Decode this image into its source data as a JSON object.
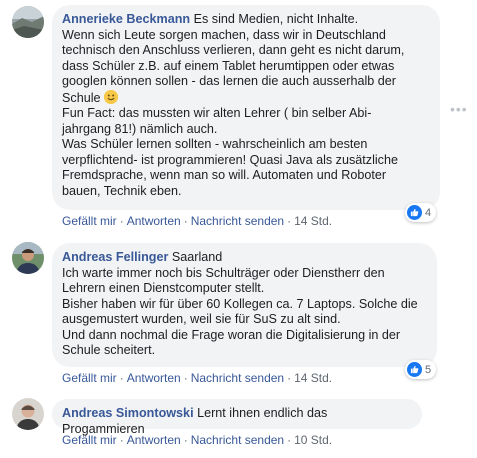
{
  "comments": [
    {
      "author": "Annerieke Beckmann",
      "text_before_emoji": " Es sind Medien, nicht Inhalte.\nWenn sich Leute sorgen machen, dass wir in Deutschland\ntechnisch den Anschluss verlieren, dann geht es nicht darum,\ndass Schüler z.B. auf einem Tablet herumtippen oder etwas\ngooglen können sollen - das lernen die auch ausserhalb der\nSchule ",
      "emoji": "smile-emoji",
      "text_after_emoji": "\nFun Fact: das mussten wir alten Lehrer ( bin selber Abi-\njahrgang 81!) nämlich auch.\nWas Schüler lernen sollten - wahrscheinlich am besten\nverpflichtend- ist programmieren! Quasi Java als zusätzliche\nFremdsprache, wenn man so will. Automaten und Roboter\nbauen, Technik eben.",
      "like_label": "Gefällt mir",
      "reply_label": "Antworten",
      "message_label": "Nachricht senden",
      "time": "14 Std.",
      "reaction_count": "4"
    },
    {
      "author": "Andreas Fellinger",
      "text": " Saarland\nIch warte immer noch bis Schulträger oder Dienstherr den\nLehrern einen Dienstcomputer stellt.\nBisher haben wir für über 60 Kollegen ca. 7 Laptops. Solche die\nausgemustert wurden, weil sie für SuS zu alt sind.\nUnd dann nochmal die Frage woran die Digitalisierung in der\nSchule scheitert.",
      "like_label": "Gefällt mir",
      "reply_label": "Antworten",
      "message_label": "Nachricht senden",
      "time": "14 Std.",
      "reaction_count": "5"
    },
    {
      "author": "Andreas Simontowski",
      "text": " Lernt ihnen endlich das Progammieren",
      "like_label": "Gefällt mir",
      "reply_label": "Antworten",
      "message_label": "Nachricht senden",
      "time": "10 Std."
    }
  ],
  "colors": {
    "author": "#385898",
    "bubble": "#f2f3f5",
    "like": "#1877f2"
  },
  "more_icon": "more-horizontal-icon",
  "separator": "·"
}
